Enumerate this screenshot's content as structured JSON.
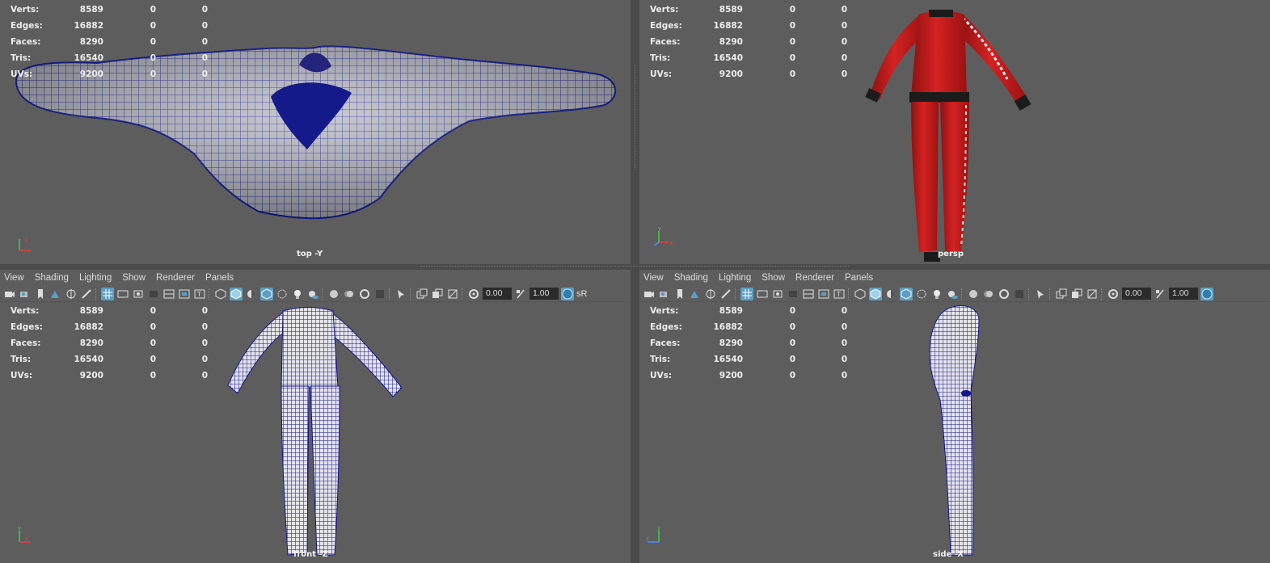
{
  "stats": {
    "labels": [
      "Verts:",
      "Edges:",
      "Faces:",
      "Tris:",
      "UVs:"
    ],
    "values": [
      "8589",
      "16882",
      "8290",
      "16540",
      "9200"
    ],
    "zero": "0"
  },
  "cameras": {
    "top": "top -Y",
    "persp": "persp",
    "front": "front -Z",
    "side": "side -X"
  },
  "menu": [
    "View",
    "Shading",
    "Lighting",
    "Show",
    "Renderer",
    "Panels"
  ],
  "toolbar": {
    "exposure": "0.00",
    "gamma": "1.00",
    "colorspace": "sR"
  },
  "colors": {
    "viewport_bg": "#5d5d5d",
    "wire": "#1a1a8c",
    "suit_red": "#c41a1a",
    "highlight": "#5b9fc4"
  }
}
